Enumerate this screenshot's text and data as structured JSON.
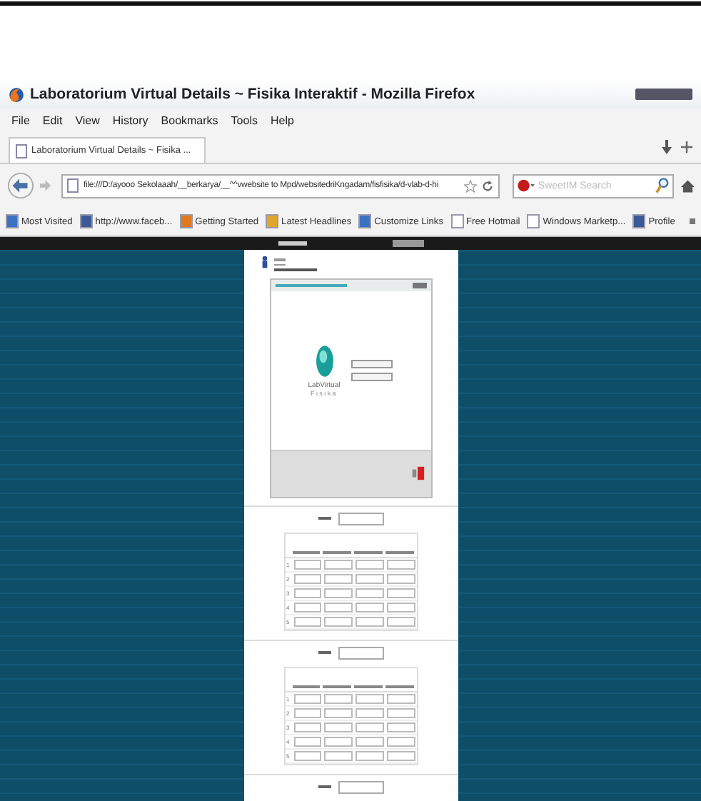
{
  "window": {
    "title": "Laboratorium Virtual Details ~ Fisika Interaktif - Mozilla Firefox"
  },
  "menu": [
    "File",
    "Edit",
    "View",
    "History",
    "Bookmarks",
    "Tools",
    "Help"
  ],
  "tabs": [
    {
      "label": "Laboratorium Virtual Details ~ Fisika ...",
      "selected": true
    }
  ],
  "address": {
    "value": "file:///D:/ayooo Sekolaaah/__berkarya/__^^vwebsite to Mpd/websitedriKngadam/fisfisika/d-vlab-d-hi"
  },
  "search": {
    "placeholder": "SweetIM Search"
  },
  "bookmarks": [
    {
      "label": "Most Visited",
      "kind": "blue"
    },
    {
      "label": "http://www.faceb...",
      "kind": "facebook"
    },
    {
      "label": "Getting Started",
      "kind": "firefox"
    },
    {
      "label": "Latest Headlines",
      "kind": "rss"
    },
    {
      "label": "Customize Links",
      "kind": "blue"
    },
    {
      "label": "Free Hotmail",
      "kind": "page"
    },
    {
      "label": "Windows Marketp...",
      "kind": "page"
    },
    {
      "label": "Profile",
      "kind": "facebook"
    }
  ],
  "page": {
    "app_logo": {
      "name": "LabVirtual",
      "subtitle": "Fisika"
    },
    "sections": [
      {
        "kind": "table",
        "rows": [
          "1",
          "2",
          "3",
          "4",
          "5"
        ]
      },
      {
        "kind": "table",
        "rows": [
          "1",
          "2",
          "3",
          "4",
          "5"
        ]
      },
      {
        "kind": "label_only"
      }
    ]
  }
}
